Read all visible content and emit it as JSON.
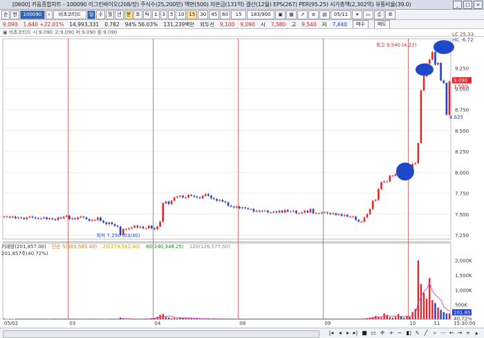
{
  "window": {
    "title": "[0600] 키움종합차트 - 100090 이그린바이오(208/장) 주식수(25,200만) 액면(500) 자본금(131억) 결산(12월) EPS(267) PER(95.25) 시가총액(2,302억) 유통비율(39.0)"
  },
  "toolbar": {
    "buttons": [
      "순",
      "현",
      "100090",
      "비초코티드",
      "일",
      "수",
      "월",
      "년",
      "분",
      "초",
      "틱",
      "1",
      "3",
      "5",
      "10",
      "15",
      "30",
      "45",
      "60",
      "15",
      "183/900"
    ],
    "date": "05/11"
  },
  "quote": {
    "price": "9,090",
    "change": "1,640 +22.01%",
    "volume": "14,993,331",
    "turnover": "0.782",
    "rate": "94% 56.03%",
    "amount": "131,239백만",
    "prev": "외두선",
    "cur": "9,100",
    "bid": "9,090",
    "open_label": "시",
    "open": "7,580",
    "high_label": "고",
    "high": "9,540",
    "low_label": "저",
    "low": "7,440",
    "buy_label": "매수",
    "sell_label": "매도"
  },
  "legend": {
    "text": "▣ 비초코티드 시:9.090 고:9.090 저:9.090 종:9.090"
  },
  "price_axis": {
    "ticks": [
      "9.250",
      "9.000",
      "8.750",
      "8.500",
      "8.250",
      "8.000",
      "7.750",
      "7.500",
      "7.250"
    ],
    "top_labels": [
      "LC 25.33",
      "HC -6.72"
    ],
    "current_price": "9.090",
    "current_pct": "1.50%"
  },
  "annotations": {
    "high": "최고 9.540 (4.22)",
    "low": "최저 7.250 (03/30)",
    "marker": "8.625"
  },
  "volume_legend": {
    "vol": "거래량(201,857.00)",
    "ma5": "단순 5(903,565.40)",
    "ma20": "20(279,562.40)",
    "ma60": "60(240,348.25)",
    "ma120": "120(126,577.50)",
    "value": "201.857주(40.72%)"
  },
  "volume_axis": {
    "ticks": [
      "2,000K",
      "1,500K",
      "1,000K",
      "500K"
    ],
    "current": "201.857",
    "pct": "40.72%"
  },
  "x_axis": {
    "labels": [
      "05/02",
      "03",
      "04",
      "08",
      "09",
      "10",
      "11"
    ],
    "time": "15:30:00"
  },
  "chart_data": {
    "type": "candlestick",
    "price_range": [
      7200,
      9600
    ],
    "volume_max": 2250000,
    "price_series": [
      7470,
      7470,
      7460,
      7470,
      7450,
      7460,
      7455,
      7440,
      7460,
      7470,
      7460,
      7450,
      7445,
      7450,
      7460,
      7440,
      7450,
      7440,
      7430,
      7460,
      7450,
      7470,
      7480,
      7440,
      7450,
      7440,
      7460,
      7470,
      7460,
      7440,
      7420,
      7430,
      7430,
      7460,
      7420,
      7400,
      7380,
      7400,
      7380,
      7360,
      7350,
      7250,
      7320,
      7320,
      7330,
      7340,
      7360,
      7340,
      7350,
      7330,
      7330,
      7360,
      7330,
      7320,
      7350,
      7410,
      7630,
      7650,
      7620,
      7660,
      7700,
      7710,
      7720,
      7700,
      7700,
      7730,
      7720,
      7710,
      7700,
      7690,
      7720,
      7740,
      7720,
      7690,
      7680,
      7660,
      7670,
      7650,
      7640,
      7600,
      7590,
      7580,
      7590,
      7570,
      7580,
      7570,
      7560,
      7560,
      7530,
      7540,
      7530,
      7540,
      7540,
      7520,
      7520,
      7530,
      7520,
      7540,
      7520,
      7550,
      7530,
      7530,
      7540,
      7510,
      7510,
      7520,
      7540,
      7520,
      7560,
      7510,
      7510,
      7510,
      7520,
      7520,
      7510,
      7500,
      7510,
      7490,
      7500,
      7480,
      7490,
      7470,
      7470,
      7470,
      7430,
      7410,
      7410,
      7460,
      7500,
      7560,
      7660,
      7670,
      7800,
      7880,
      7890,
      7890,
      7960,
      7960,
      7980,
      8050,
      8010,
      8050,
      8050,
      8010,
      8100,
      8110,
      8350,
      8980,
      9150,
      9300,
      9350,
      9440,
      9290,
      9310,
      9100,
      9070,
      8690,
      9090
    ],
    "volume_series": [
      30000,
      10000,
      20000,
      15000,
      10000,
      20000,
      5000,
      10000,
      20000,
      5000,
      10000,
      15000,
      5000,
      10000,
      20000,
      5000,
      10000,
      20000,
      5000,
      15000,
      10000,
      5000,
      20000,
      10000,
      15000,
      5000,
      5000,
      10000,
      20000,
      10000,
      15000,
      5000,
      10000,
      5000,
      20000,
      5000,
      10000,
      15000,
      5000,
      10000,
      20000,
      60000,
      20000,
      15000,
      10000,
      5000,
      20000,
      10000,
      15000,
      10000,
      30000,
      20000,
      40000,
      50000,
      90000,
      150000,
      180000,
      80000,
      60000,
      40000,
      50000,
      30000,
      70000,
      40000,
      60000,
      40000,
      30000,
      20000,
      30000,
      20000,
      25000,
      15000,
      20000,
      15000,
      25000,
      20000,
      15000,
      10000,
      15000,
      20000,
      10000,
      20000,
      10000,
      15000,
      20000,
      10000,
      5000,
      15000,
      20000,
      10000,
      15000,
      10000,
      20000,
      10000,
      15000,
      5000,
      20000,
      10000,
      15000,
      10000,
      20000,
      10000,
      15000,
      5000,
      10000,
      20000,
      10000,
      15000,
      10000,
      20000,
      10000,
      15000,
      5000,
      10000,
      15000,
      20000,
      10000,
      15000,
      5000,
      10000,
      20000,
      15000,
      10000,
      5000,
      15000,
      20000,
      25000,
      30000,
      40000,
      60000,
      80000,
      120000,
      90000,
      60000,
      200000,
      150000,
      80000,
      60000,
      90000,
      180000,
      100000,
      60000,
      120000,
      80000,
      250000,
      350000,
      2000000,
      1200000,
      900000,
      700000,
      1400000,
      650000,
      550000,
      400000,
      320000,
      250000,
      200000,
      200000
    ]
  },
  "colors": {
    "up": "#e3262c",
    "down": "#2040c8",
    "grid_red": "#c23a3a",
    "highlight": "#1e48c8"
  }
}
